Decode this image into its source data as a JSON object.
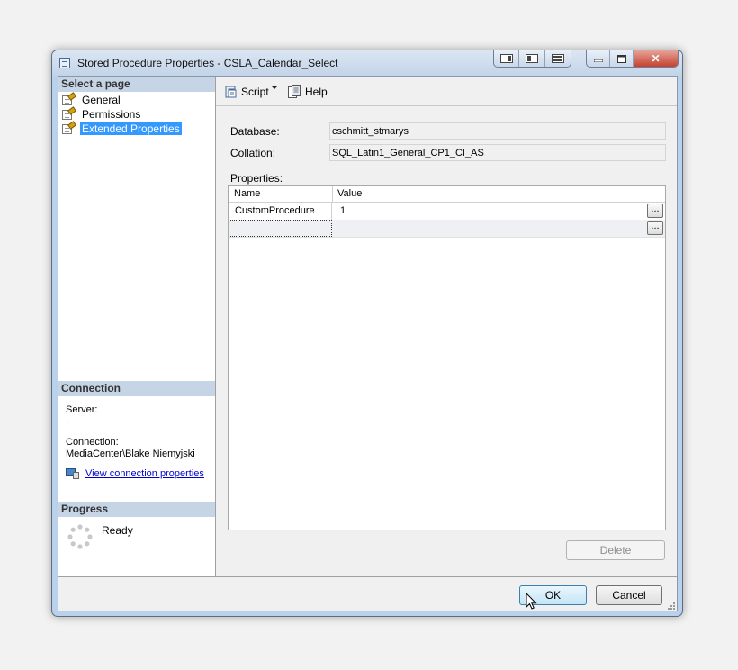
{
  "window": {
    "title": "Stored Procedure Properties - CSLA_Calendar_Select",
    "caption_buttons": [
      "minimize",
      "maximize",
      "close"
    ],
    "close_glyph": "✕"
  },
  "left": {
    "select_page_header": "Select a page",
    "pages": [
      {
        "label": "General",
        "icon": "properties-page-icon",
        "selected": false
      },
      {
        "label": "Permissions",
        "icon": "properties-page-icon",
        "selected": false
      },
      {
        "label": "Extended Properties",
        "icon": "properties-page-icon",
        "selected": true
      }
    ],
    "connection_header": "Connection",
    "server_label": "Server:",
    "server_value": ".",
    "connection_label": "Connection:",
    "connection_value": "MediaCenter\\Blake Niemyjski",
    "view_connection_link": "View connection properties",
    "progress_header": "Progress",
    "progress_status": "Ready"
  },
  "toolbar": {
    "script_label": "Script",
    "help_label": "Help"
  },
  "form": {
    "database_label": "Database:",
    "database_value": "cschmitt_stmarys",
    "collation_label": "Collation:",
    "collation_value": "SQL_Latin1_General_CP1_CI_AS",
    "properties_label": "Properties:"
  },
  "grid": {
    "columns": [
      "Name",
      "Value"
    ],
    "rows": [
      {
        "name": "CustomProcedure",
        "value": "1"
      },
      {
        "name": "",
        "value": ""
      }
    ],
    "ellipsis": "..."
  },
  "buttons": {
    "delete": "Delete",
    "ok": "OK",
    "cancel": "Cancel"
  },
  "colors": {
    "selection": "#3399ff",
    "section_header": "#c5d5e5",
    "link": "#0000cc"
  }
}
